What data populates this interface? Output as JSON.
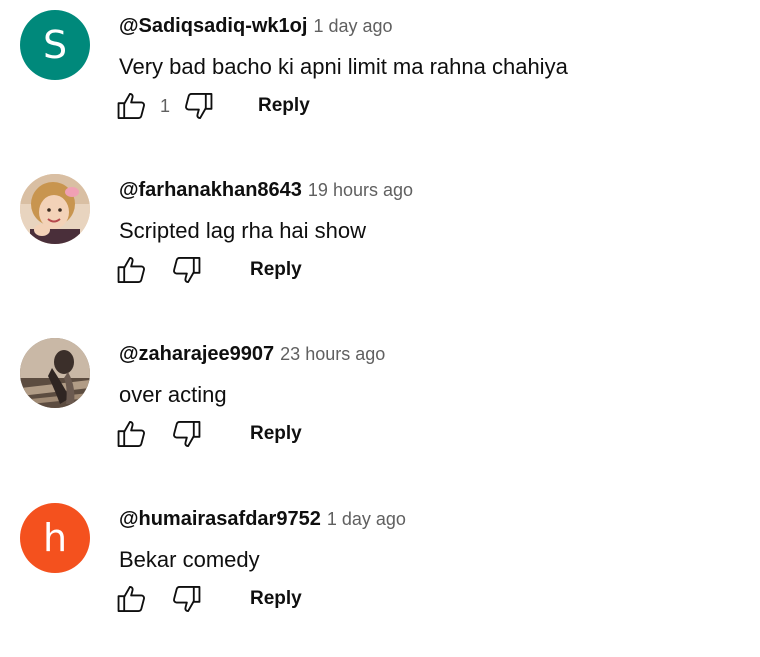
{
  "comments": [
    {
      "author": "@Sadiqsadiq-wk1oj",
      "time": "1 day ago",
      "text": "Very bad bacho ki apni limit ma rahna chahiya",
      "likes": "1",
      "avatar_type": "letter",
      "avatar_letter": "S",
      "avatar_color": "#00897b",
      "reply_label": "Reply"
    },
    {
      "author": "@farhanakhan8643",
      "time": "19 hours ago",
      "text": "Scripted lag rha hai show",
      "likes": "",
      "avatar_type": "photo",
      "reply_label": "Reply"
    },
    {
      "author": "@zaharajee9907",
      "time": "23 hours ago",
      "text": "over acting",
      "likes": "",
      "avatar_type": "photo",
      "reply_label": "Reply"
    },
    {
      "author": "@humairasafdar9752",
      "time": "1 day ago",
      "text": "Bekar comedy",
      "likes": "",
      "avatar_type": "letter",
      "avatar_letter": "h",
      "avatar_color": "#f4511e",
      "reply_label": "Reply"
    }
  ],
  "icons": {
    "like": "thumbs-up-icon",
    "dislike": "thumbs-down-icon"
  },
  "colors": {
    "text_primary": "#0f0f0f",
    "text_secondary": "#606060"
  }
}
